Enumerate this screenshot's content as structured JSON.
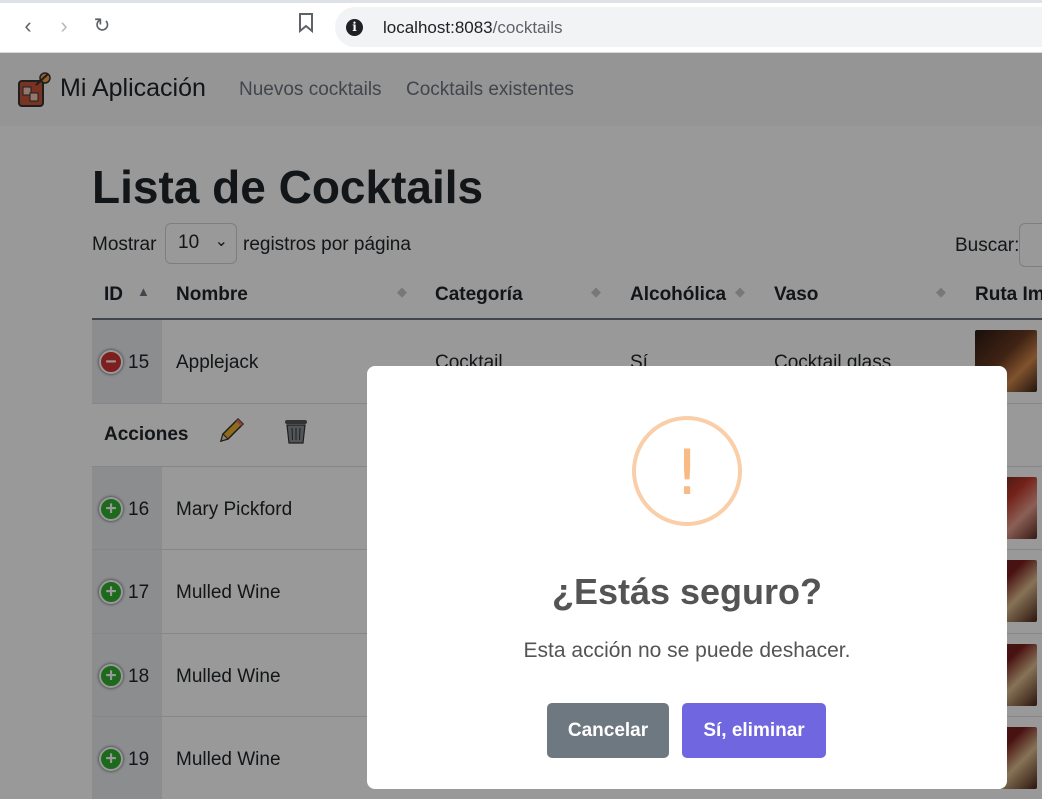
{
  "browser": {
    "url_host": "localhost:8083",
    "url_path": "/cocktails"
  },
  "navbar": {
    "brand": "Mi Aplicación",
    "links": [
      "Nuevos cocktails",
      "Cocktails existentes"
    ]
  },
  "page": {
    "title": "Lista de Cocktails",
    "show_label": "Mostrar",
    "page_size": "10",
    "per_page_label": "registros por página",
    "search_label": "Buscar:"
  },
  "table": {
    "headers": [
      "ID",
      "Nombre",
      "Categoría",
      "Alcohólica",
      "Vaso",
      "Ruta Im"
    ],
    "rows": [
      {
        "id": "15",
        "name": "Applejack",
        "category": "Cocktail",
        "alcoholic": "Sí",
        "glass": "Cocktail glass",
        "expanded": true
      },
      {
        "id": "16",
        "name": "Mary Pickford"
      },
      {
        "id": "17",
        "name": "Mulled Wine"
      },
      {
        "id": "18",
        "name": "Mulled Wine"
      },
      {
        "id": "19",
        "name": "Mulled Wine"
      }
    ],
    "actions_label": "Acciones"
  },
  "modal": {
    "icon": "warning-exclamation-icon",
    "mark": "!",
    "title": "¿Estás seguro?",
    "text": "Esta acción no se puede deshacer.",
    "cancel_label": "Cancelar",
    "confirm_label": "Sí, eliminar",
    "colors": {
      "warning": "#f8bb86",
      "cancel": "#6e7881",
      "confirm": "#7066e0"
    }
  }
}
